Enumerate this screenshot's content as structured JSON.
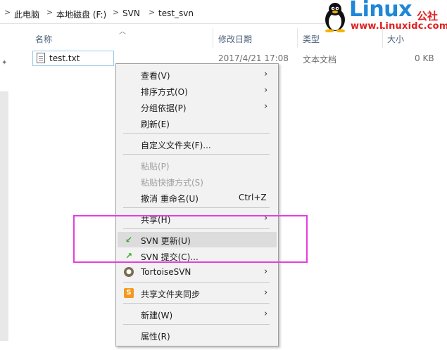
{
  "breadcrumb": {
    "items": [
      "此电脑",
      "本地磁盘 (F:)",
      "SVN",
      "test_svn"
    ],
    "separator": ">"
  },
  "logo": {
    "title": "Linux",
    "cn": "公社",
    "url": "www.Linuxidc.com"
  },
  "columns": {
    "name": "名称",
    "modified": "修改日期",
    "type": "类型",
    "size": "大小"
  },
  "file": {
    "name": "test.txt",
    "modified": "2017/4/21 17:08",
    "type": "文本文档",
    "size": "0 KB"
  },
  "menu": {
    "view": "查看(V)",
    "sort": "排序方式(O)",
    "group": "分组依据(P)",
    "refresh": "刷新(E)",
    "customize": "自定义文件夹(F)...",
    "paste": "粘贴(P)",
    "paste_shortcut": "粘贴快捷方式(S)",
    "undo": "撤消 重命名(U)",
    "undo_shortcut": "Ctrl+Z",
    "share": "共享(H)",
    "svn_update": "SVN 更新(U)",
    "svn_commit": "SVN 提交(C)...",
    "tortoise": "TortoiseSVN",
    "share_sync": "共享文件夹同步",
    "new": "新建(W)",
    "properties": "属性(R)",
    "submenu_arrow": "›",
    "icon_sync_glyph": "S"
  },
  "colors": {
    "highlight_box": "#e63de0",
    "logo_blue": "#1f87d8",
    "logo_red": "#e02020",
    "menu_bg": "#f2f2f2"
  },
  "icons": {
    "svn_update": "svn-update-icon",
    "svn_commit": "svn-commit-icon",
    "tortoise": "tortoisesvn-icon",
    "share_sync": "share-sync-icon",
    "file": "text-file-icon"
  }
}
